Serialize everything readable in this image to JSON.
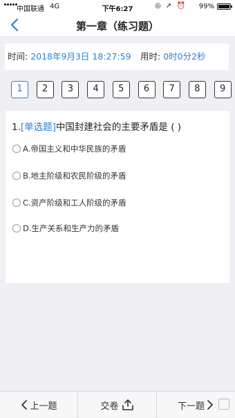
{
  "status_bar": {
    "carrier": "中国联通",
    "network": "4G",
    "time": "下午6:27",
    "battery": "99%"
  },
  "nav": {
    "title": "第一章（练习题）"
  },
  "timer": {
    "time_label": "时间:",
    "time_value": "2018年9月3日 18:27:59",
    "used_label": "用时:",
    "used_value": "0时0分2秒"
  },
  "question_numbers": [
    "1",
    "2",
    "3",
    "4",
    "5",
    "6",
    "7",
    "8",
    "9"
  ],
  "active_question": "1",
  "question": {
    "number": "1.",
    "type": "[单选题]",
    "text": "中国封建社会的主要矛盾是 ( )",
    "options": [
      "A.帝国主义和中华民族的矛盾",
      "B.地主阶级和农民阶级的矛盾",
      "C.资产阶级和工人阶级的矛盾",
      "D.生产关系和生产力的矛盾"
    ]
  },
  "bottom_bar": {
    "prev_label": "上一题",
    "submit_label": "交卷",
    "next_label": "下一题"
  },
  "colors": {
    "accent": "#2a7fd4",
    "background": "#efeff4"
  }
}
